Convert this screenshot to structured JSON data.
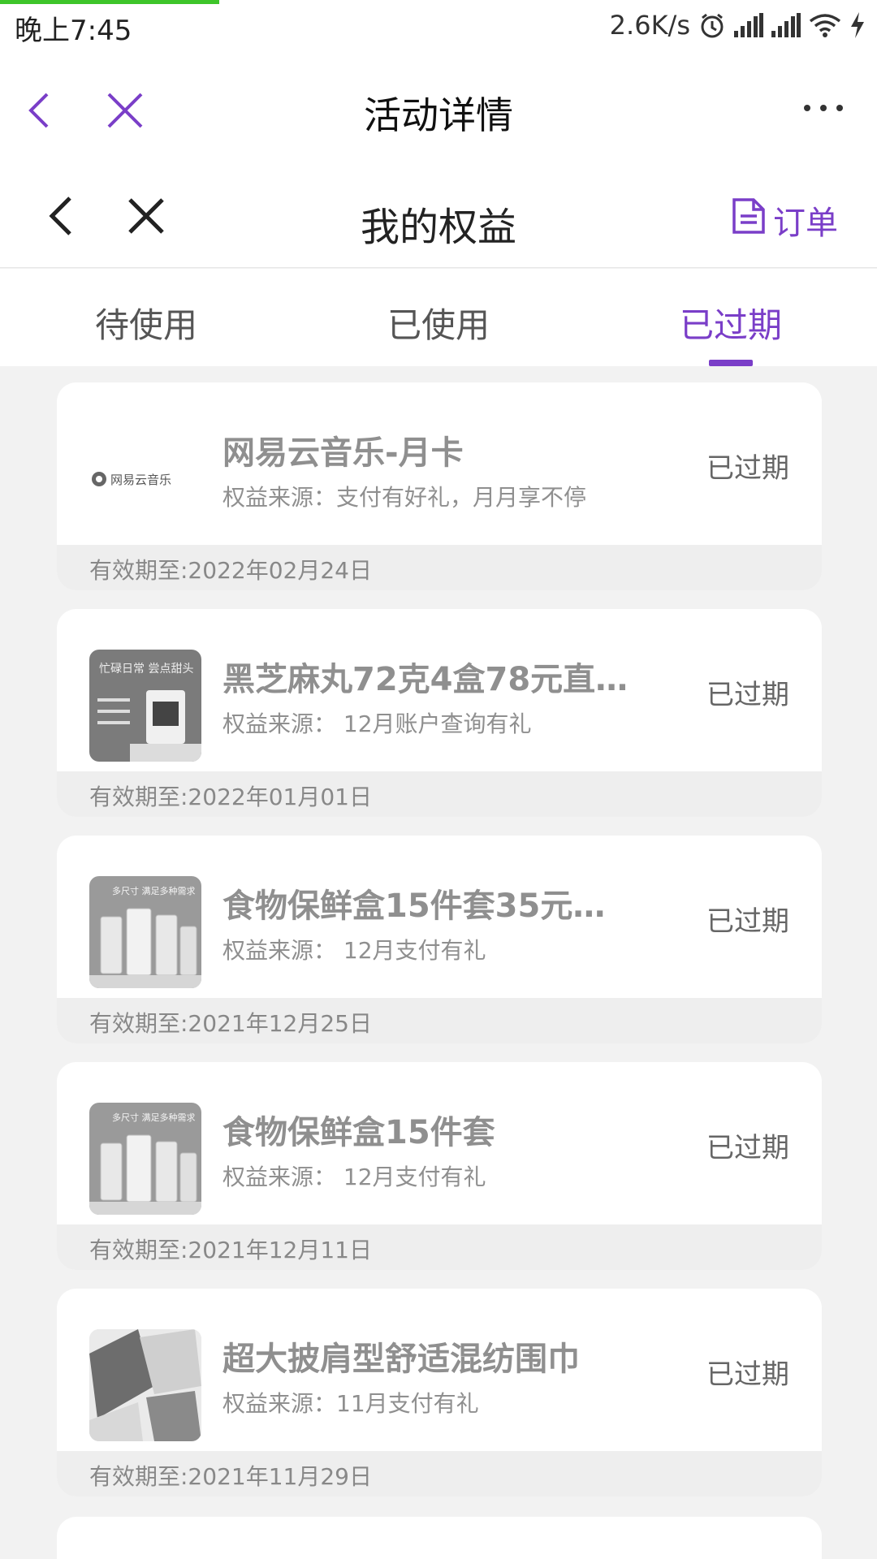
{
  "status_bar": {
    "time": "晚上7:45",
    "speed": "2.6K/s"
  },
  "web_header": {
    "title": "活动详情"
  },
  "page_header": {
    "title": "我的权益",
    "order_label": "订单"
  },
  "tabs": [
    {
      "label": "待使用",
      "active": false
    },
    {
      "label": "已使用",
      "active": false
    },
    {
      "label": "已过期",
      "active": true
    }
  ],
  "colors": {
    "accent": "#7a3ec8",
    "progress": "#3ec52a"
  },
  "cards": [
    {
      "title": "网易云音乐-月卡",
      "source": "权益来源：支付有好礼，月月享不停",
      "status": "已过期",
      "expiry": "有效期至:2022年02月24日",
      "thumb_text": "网易云音乐"
    },
    {
      "title": "黑芝麻丸72克4盒78元直…",
      "source": "权益来源： 12月账户查询有礼",
      "status": "已过期",
      "expiry": "有效期至:2022年01月01日",
      "thumb_text": "忙碌日常 尝点甜头"
    },
    {
      "title": "食物保鲜盒15件套35元…",
      "source": "权益来源： 12月支付有礼",
      "status": "已过期",
      "expiry": "有效期至:2021年12月25日",
      "thumb_text": "多尺寸 满足多种需求"
    },
    {
      "title": "食物保鲜盒15件套",
      "source": "权益来源： 12月支付有礼",
      "status": "已过期",
      "expiry": "有效期至:2021年12月11日",
      "thumb_text": "多尺寸 满足多种需求"
    },
    {
      "title": "超大披肩型舒适混纺围巾",
      "source": "权益来源：11月支付有礼",
      "status": "已过期",
      "expiry": "有效期至:2021年11月29日",
      "thumb_text": ""
    }
  ]
}
